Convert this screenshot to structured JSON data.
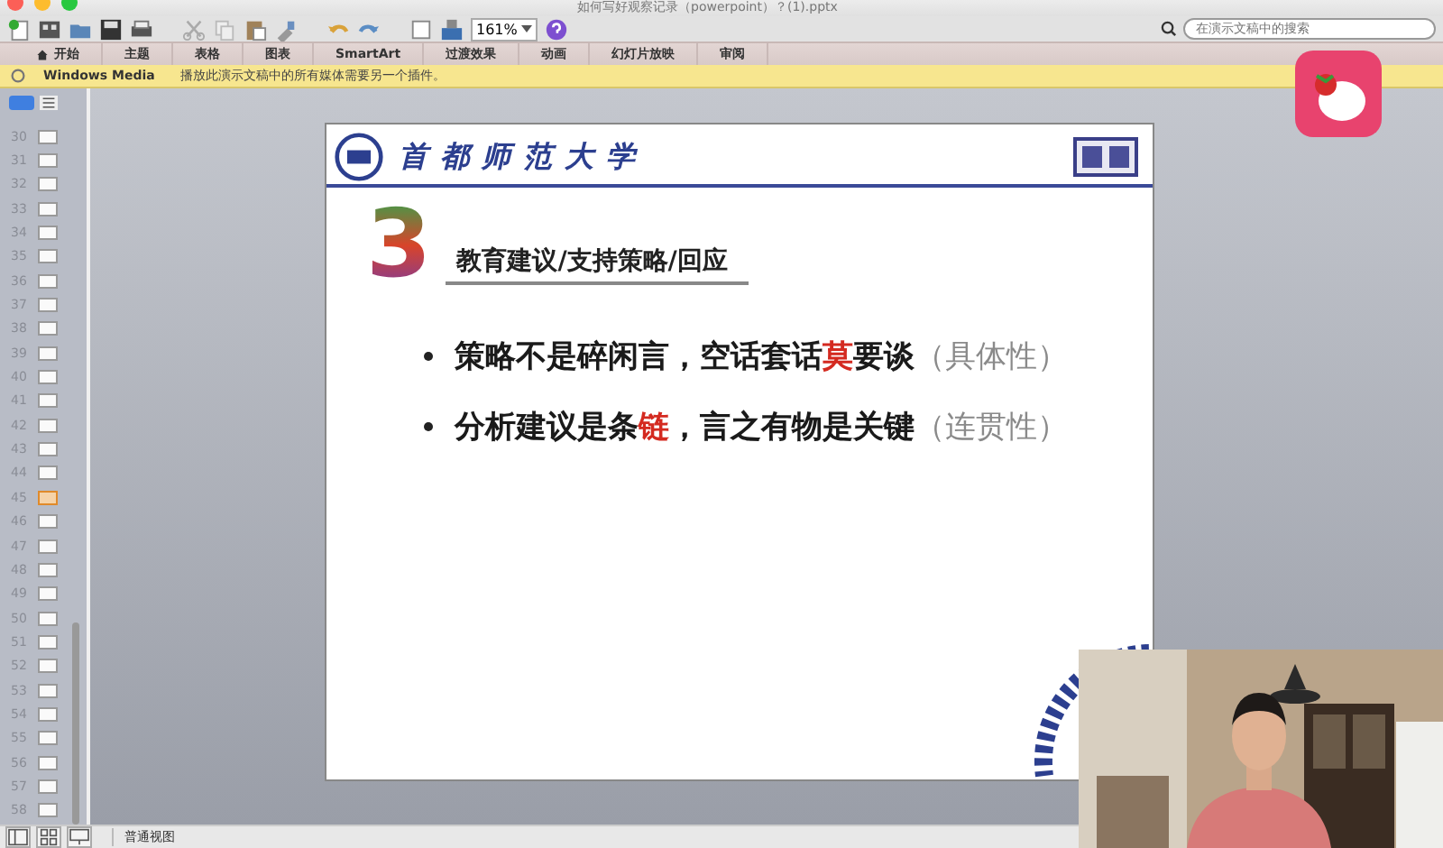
{
  "window": {
    "title": "如何写好观察记录（powerpoint）？(1).pptx"
  },
  "toolbar": {
    "zoom": "161%"
  },
  "search": {
    "placeholder": "在演示文稿中的搜索"
  },
  "ribbon_tabs": [
    {
      "label": "开始",
      "selected": false
    },
    {
      "label": "主题",
      "selected": false
    },
    {
      "label": "表格",
      "selected": false
    },
    {
      "label": "图表",
      "selected": false
    },
    {
      "label": "SmartArt",
      "selected": false
    },
    {
      "label": "过渡效果",
      "selected": false
    },
    {
      "label": "动画",
      "selected": false
    },
    {
      "label": "幻灯片放映",
      "selected": false
    },
    {
      "label": "审阅",
      "selected": false
    }
  ],
  "message_bar": {
    "title": "Windows Media",
    "text": "播放此演示文稿中的所有媒体需要另一个插件。"
  },
  "slides": [
    {
      "number": "30",
      "selected": false
    },
    {
      "number": "31",
      "selected": false
    },
    {
      "number": "32",
      "selected": false
    },
    {
      "number": "33",
      "selected": false
    },
    {
      "number": "34",
      "selected": false
    },
    {
      "number": "35",
      "selected": false
    },
    {
      "number": "36",
      "selected": false
    },
    {
      "number": "37",
      "selected": false
    },
    {
      "number": "38",
      "selected": false
    },
    {
      "number": "39",
      "selected": false
    },
    {
      "number": "40",
      "selected": false
    },
    {
      "number": "41",
      "selected": false
    },
    {
      "number": "42",
      "selected": false
    },
    {
      "number": "43",
      "selected": false
    },
    {
      "number": "44",
      "selected": false
    },
    {
      "number": "45",
      "selected": true
    },
    {
      "number": "46",
      "selected": false
    },
    {
      "number": "47",
      "selected": false
    },
    {
      "number": "48",
      "selected": false
    },
    {
      "number": "49",
      "selected": false
    },
    {
      "number": "50",
      "selected": false
    },
    {
      "number": "51",
      "selected": false
    },
    {
      "number": "52",
      "selected": false
    },
    {
      "number": "53",
      "selected": false
    },
    {
      "number": "54",
      "selected": false
    },
    {
      "number": "55",
      "selected": false
    },
    {
      "number": "56",
      "selected": false
    },
    {
      "number": "57",
      "selected": false
    },
    {
      "number": "58",
      "selected": false
    }
  ],
  "slide": {
    "university": "首都师范大学",
    "section_number": "3",
    "heading": "教育建议/支持策略/回应",
    "bullets": [
      {
        "parts": [
          {
            "kind": "normal",
            "text": "策略不是碎闲言，空话套话"
          },
          {
            "kind": "highlight",
            "text": "莫"
          },
          {
            "kind": "normal",
            "text": "要谈"
          },
          {
            "kind": "aside",
            "text": "（具体性）"
          }
        ]
      },
      {
        "parts": [
          {
            "kind": "normal",
            "text": "分析建议是条"
          },
          {
            "kind": "highlight",
            "text": "链"
          },
          {
            "kind": "normal",
            "text": "，言之有物是关键"
          },
          {
            "kind": "aside",
            "text": "（连贯性）"
          }
        ]
      }
    ]
  },
  "status_bar": {
    "view": "普通视图"
  }
}
